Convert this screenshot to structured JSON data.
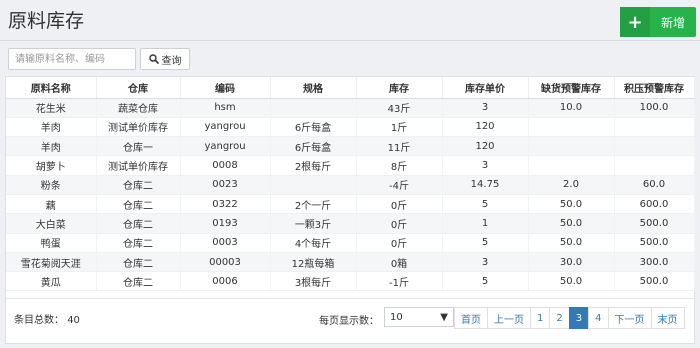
{
  "header": {
    "title": "原料库存",
    "add_label": "新增"
  },
  "search": {
    "placeholder": "请输原料名称、编码",
    "query_label": "查询"
  },
  "table": {
    "columns": [
      "原料名称",
      "仓库",
      "编码",
      "规格",
      "库存",
      "库存单价",
      "缺货预警库存",
      "积压预警库存"
    ],
    "rows": [
      [
        "花生米",
        "蔬菜仓库",
        "hsm",
        "",
        "43斤",
        "3",
        "10.0",
        "100.0"
      ],
      [
        "羊肉",
        "测试单价库存",
        "yangrou",
        "6斤每盒",
        "1斤",
        "120",
        "",
        ""
      ],
      [
        "羊肉",
        "仓库一",
        "yangrou",
        "6斤每盒",
        "11斤",
        "120",
        "",
        ""
      ],
      [
        "胡萝卜",
        "测试单价库存",
        "0008",
        "2根每斤",
        "8斤",
        "3",
        "",
        ""
      ],
      [
        "粉条",
        "仓库二",
        "0023",
        "",
        "-4斤",
        "14.75",
        "2.0",
        "60.0"
      ],
      [
        "藕",
        "仓库二",
        "0322",
        "2个一斤",
        "0斤",
        "5",
        "50.0",
        "600.0"
      ],
      [
        "大白菜",
        "仓库二",
        "0193",
        "一颗3斤",
        "0斤",
        "1",
        "50.0",
        "500.0"
      ],
      [
        "鸭蛋",
        "仓库二",
        "0003",
        "4个每斤",
        "0斤",
        "5",
        "50.0",
        "500.0"
      ],
      [
        "雪花菊阅天涯",
        "仓库二",
        "00003",
        "12瓶每箱",
        "0箱",
        "3",
        "30.0",
        "300.0"
      ],
      [
        "黄瓜",
        "仓库二",
        "0006",
        "3根每斤",
        "-1斤",
        "5",
        "50.0",
        "500.0"
      ]
    ]
  },
  "footer": {
    "total_label": "条目总数：",
    "total_value": "40",
    "page_size_label": "每页显示数：",
    "page_size_value": "10",
    "pagination": [
      "首页",
      "上一页",
      "1",
      "2",
      "3",
      "4",
      "下一页",
      "末页"
    ],
    "active_page": "3"
  },
  "colors": {
    "accent_green": "#27b24a",
    "accent_blue": "#337ab7"
  },
  "icons": {
    "add": "plus-icon",
    "search": "search-icon",
    "dropdown": "caret-down-icon"
  }
}
